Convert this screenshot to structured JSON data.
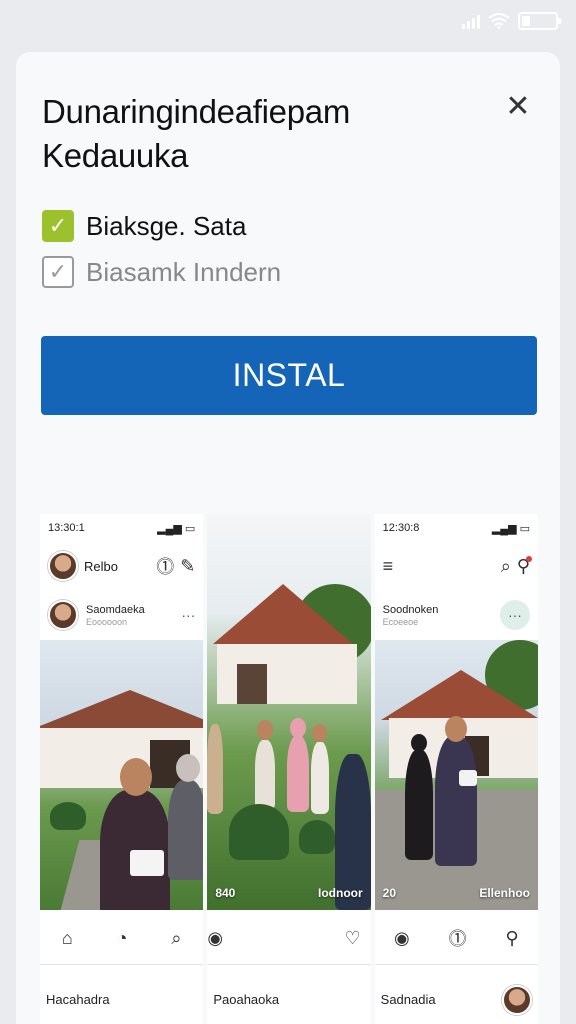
{
  "status_bar": {
    "signal_icon": "signal-icon",
    "wifi_icon": "wifi-icon",
    "battery_icon": "battery-icon"
  },
  "dialog": {
    "title": "Dunaringindeafiepam Kedauuka",
    "close_icon": "close-icon",
    "options": [
      {
        "label": "Biaksge. Sata",
        "checked": true
      },
      {
        "label": "Biasamk Inndern",
        "checked": false
      }
    ],
    "install_label": "INSTAL",
    "accent_color": "#1465b8",
    "check_color": "#9dc12c"
  },
  "screenshots": [
    {
      "time": "13:30:1",
      "header_name": "Relbo",
      "post_name": "Saomdaeka",
      "post_sub": "Eoooooon",
      "caption_left": "",
      "caption_right": "",
      "footer_text": "Hacahadra"
    },
    {
      "time": "",
      "header_name": "",
      "post_name": "",
      "post_sub": "",
      "caption_left": "840",
      "caption_right": "Iodnoor",
      "footer_text": "Paoahaoka"
    },
    {
      "time": "12:30:8",
      "header_name": "",
      "post_name": "Soodnoken",
      "post_sub": "Ecoeeoe",
      "caption_left": "20",
      "caption_right": "Ellenhoo",
      "footer_text": "Sadnadia"
    }
  ]
}
